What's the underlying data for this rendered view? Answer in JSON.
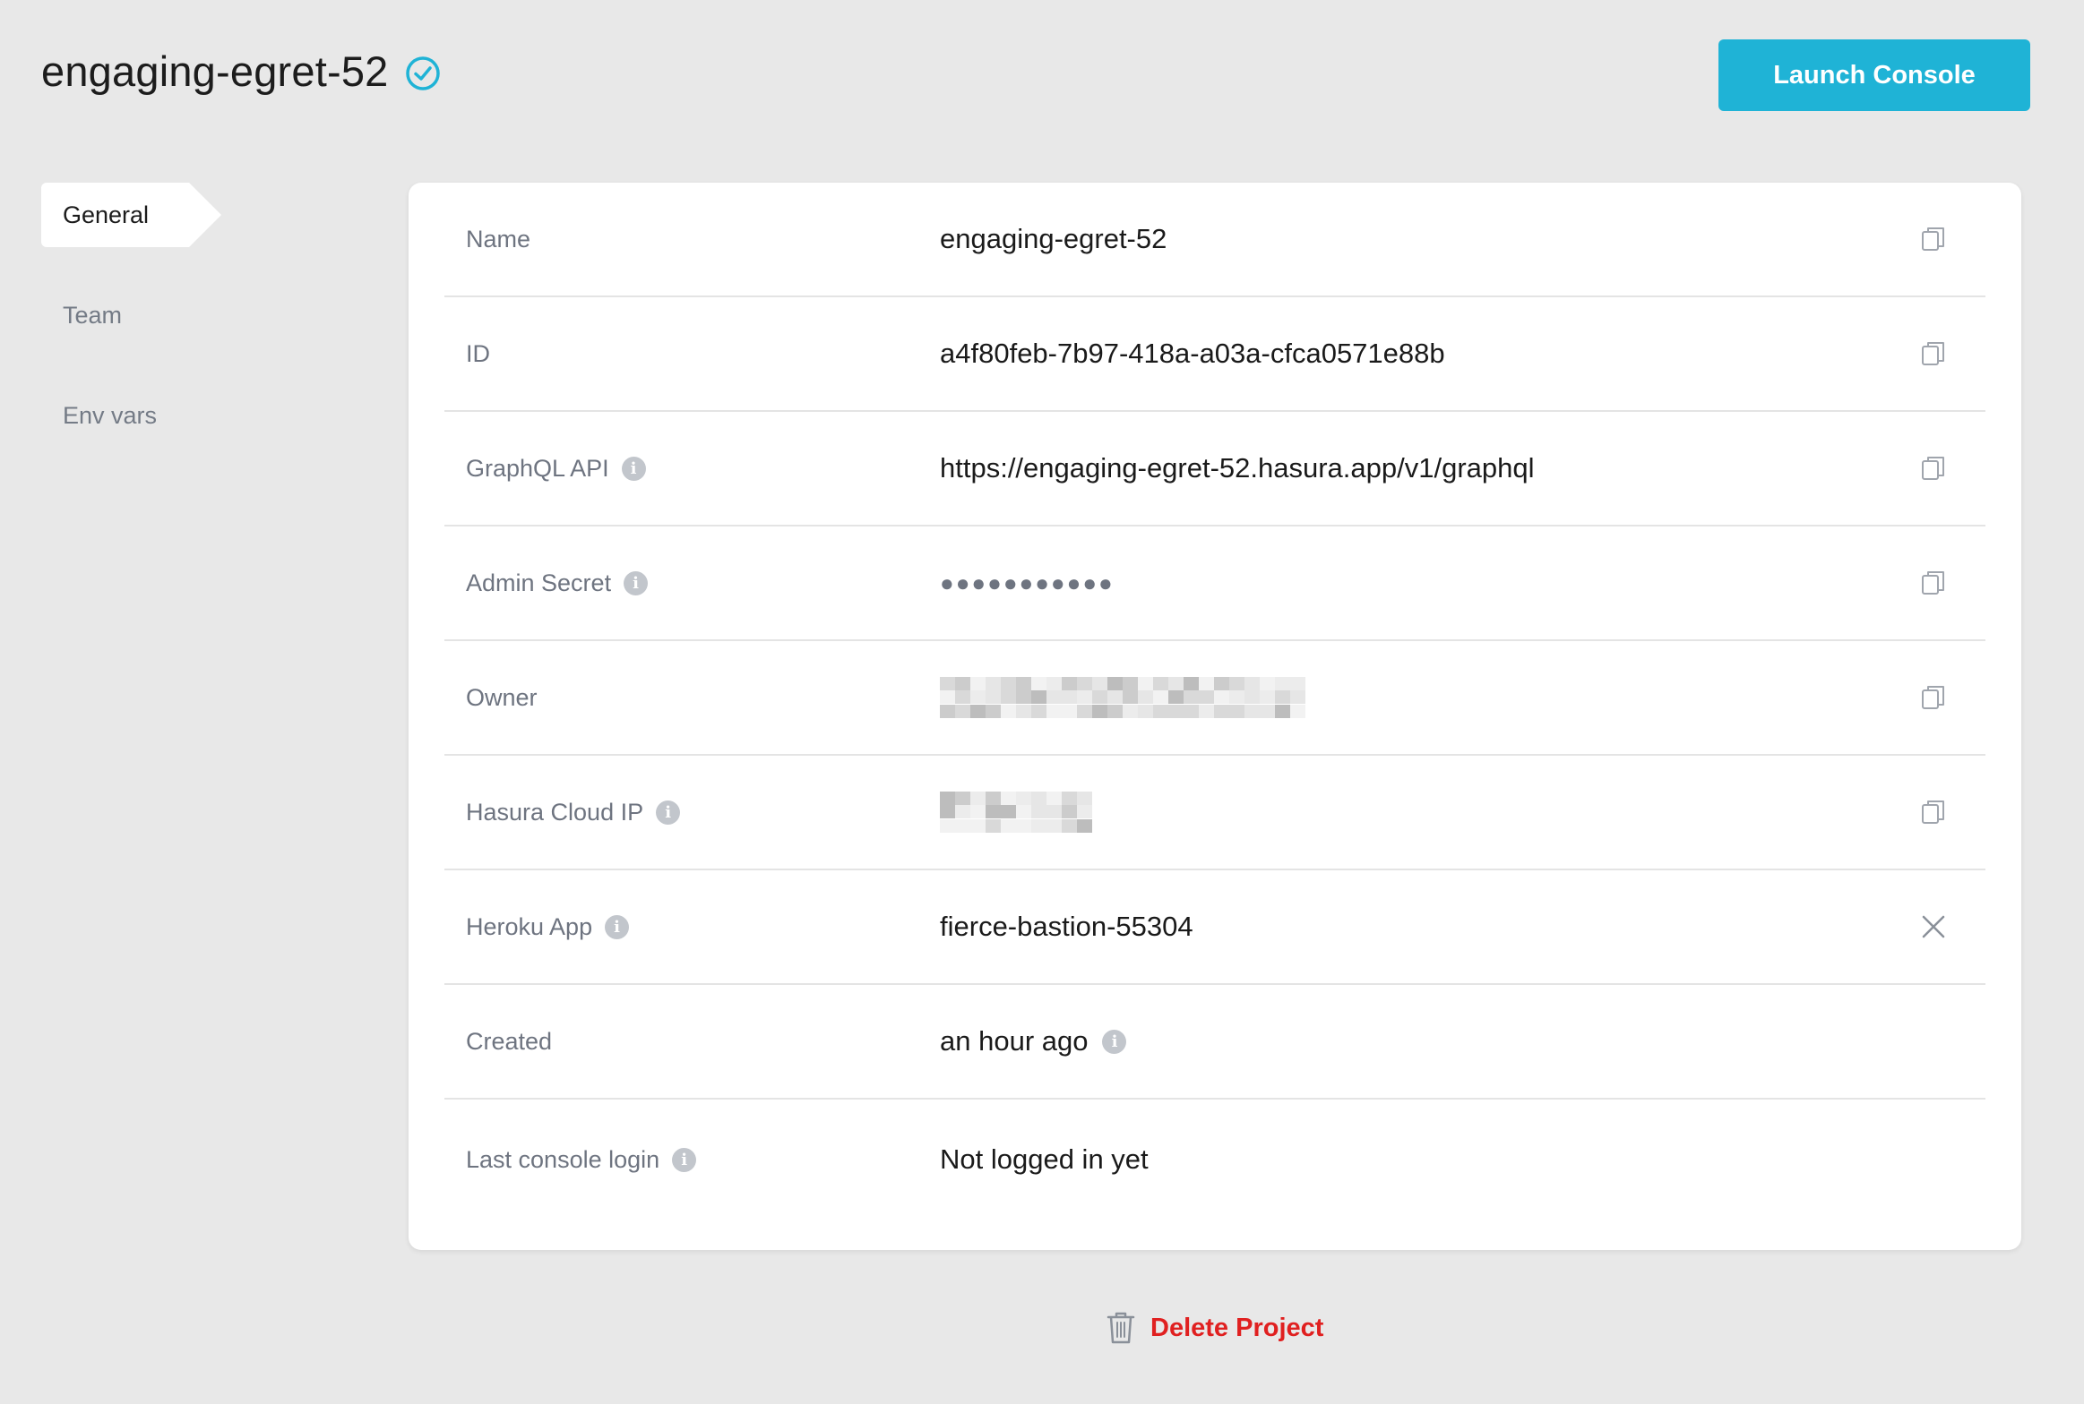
{
  "header": {
    "project_name": "engaging-egret-52",
    "launch_label": "Launch Console"
  },
  "sidebar": {
    "items": [
      {
        "label": "General",
        "active": true
      },
      {
        "label": "Team",
        "active": false
      },
      {
        "label": "Env vars",
        "active": false
      }
    ]
  },
  "details": {
    "name": {
      "label": "Name",
      "value": "engaging-egret-52"
    },
    "id": {
      "label": "ID",
      "value": "a4f80feb-7b97-418a-a03a-cfca0571e88b"
    },
    "graphql_api": {
      "label": "GraphQL API",
      "value": "https://engaging-egret-52.hasura.app/v1/graphql"
    },
    "admin_secret": {
      "label": "Admin Secret",
      "value": "●●●●●●●●●●●"
    },
    "owner": {
      "label": "Owner"
    },
    "cloud_ip": {
      "label": "Hasura Cloud IP"
    },
    "heroku_app": {
      "label": "Heroku App",
      "value": "fierce-bastion-55304"
    },
    "created": {
      "label": "Created",
      "value": "an hour ago"
    },
    "last_login": {
      "label": "Last console login",
      "value": "Not logged in yet"
    }
  },
  "footer": {
    "delete_label": "Delete Project"
  },
  "colors": {
    "accent": "#1fb3d6",
    "danger": "#e02020",
    "background": "#e8e8e8"
  }
}
